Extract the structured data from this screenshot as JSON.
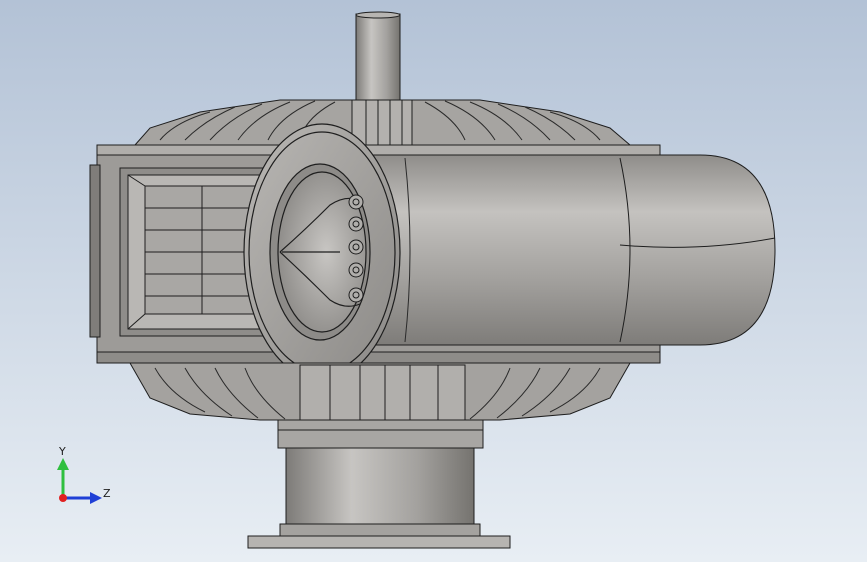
{
  "viewport": {
    "background_top": "#b3c2d6",
    "background_bottom": "#e8eef4"
  },
  "model": {
    "body_color": "#a19f9c",
    "shade_color": "#8a8885",
    "highlight_color": "#c9c7c4",
    "edge_color": "#1e1e1e"
  },
  "triad": {
    "y_label": "Y",
    "z_label": "Z",
    "y_axis_color": "#2fbf3f",
    "z_axis_color": "#1f3fd6",
    "x_axis_color": "#e02020",
    "x_icon": "triad-x-axis-dot",
    "y_icon": "triad-y-axis-arrow",
    "z_icon": "triad-z-axis-arrow"
  }
}
